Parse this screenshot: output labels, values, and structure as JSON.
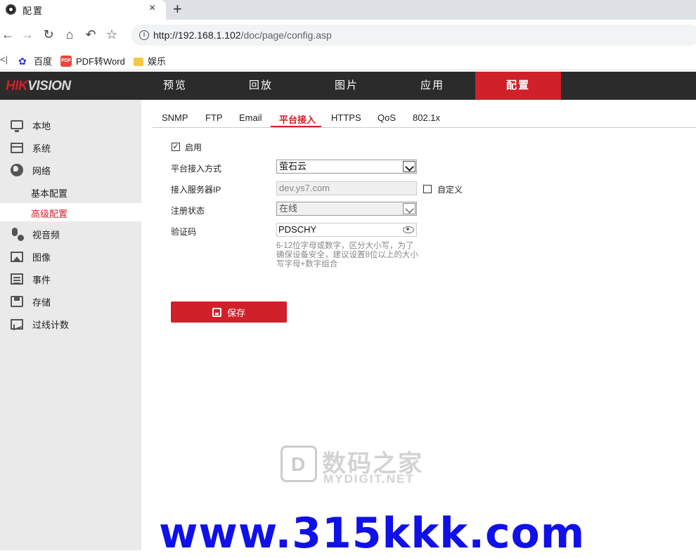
{
  "browser": {
    "tab_title": "配置",
    "close_glyph": "×",
    "new_tab_glyph": "+",
    "url_host": "http://192.168.1.102",
    "url_path": "/doc/page/config.asp",
    "bookmarks": [
      {
        "label": "百度"
      },
      {
        "label": "PDF转Word"
      },
      {
        "label": "娱乐"
      }
    ],
    "bookmark_cut_text": "<|"
  },
  "app": {
    "logo_left": "HIK",
    "logo_right": "VISION",
    "nav": [
      "预览",
      "回放",
      "图片",
      "应用",
      "配置"
    ],
    "active_nav": "配置",
    "accent_color": "#d0202a"
  },
  "sidebar": {
    "items": [
      {
        "label": "本地",
        "icon": "monitor-icon"
      },
      {
        "label": "系统",
        "icon": "window-icon"
      },
      {
        "label": "网络",
        "icon": "globe-icon"
      },
      {
        "label": "基本配置"
      },
      {
        "label": "高级配置"
      },
      {
        "label": "视音频",
        "icon": "microphone-icon"
      },
      {
        "label": "图像",
        "icon": "image-icon"
      },
      {
        "label": "事件",
        "icon": "event-icon"
      },
      {
        "label": "存储",
        "icon": "storage-icon"
      },
      {
        "label": "过线计数",
        "icon": "chart-icon"
      }
    ]
  },
  "subtabs": [
    "SNMP",
    "FTP",
    "Email",
    "平台接入",
    "HTTPS",
    "QoS",
    "802.1x"
  ],
  "form": {
    "enable_label": "启用",
    "enable_checked": "✓",
    "access_mode_label": "平台接入方式",
    "access_mode_value": "萤石云",
    "server_ip_label": "接入服务器IP",
    "server_ip_value": "dev.ys7.com",
    "custom_label": "自定义",
    "reg_status_label": "注册状态",
    "reg_status_value": "在线",
    "verify_code_label": "验证码",
    "verify_code_value": "PDSCHY",
    "hint": "6-12位字母或数字，区分大小写，为了确保设备安全，建议设置8位以上的大小写字母+数字组合",
    "save_label": "保存"
  },
  "watermarks": {
    "cn": "数码之家",
    "en": "MYDIGIT.NET",
    "site": "www.315kkk.com"
  }
}
